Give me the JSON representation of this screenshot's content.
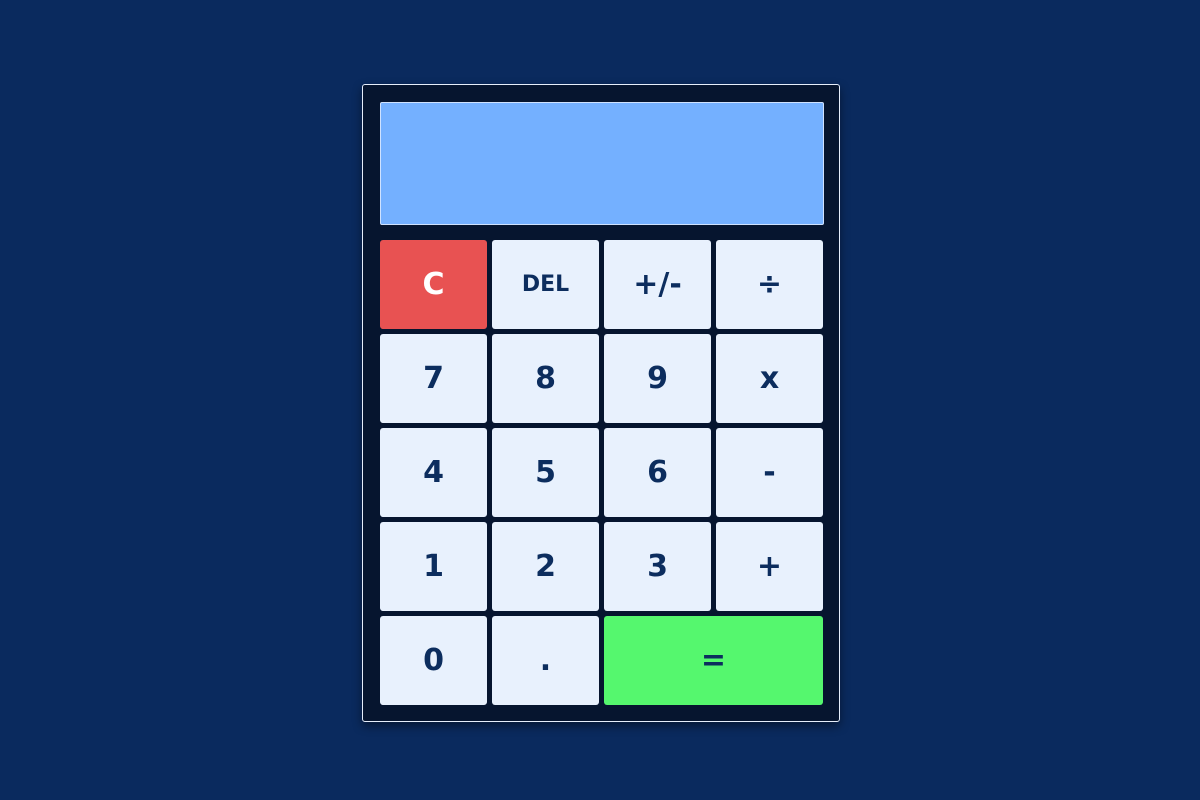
{
  "display": {
    "value": ""
  },
  "keys": {
    "clear": "C",
    "delete": "DEL",
    "negate": "+/-",
    "divide": "÷",
    "seven": "7",
    "eight": "8",
    "nine": "9",
    "multiply": "x",
    "four": "4",
    "five": "5",
    "six": "6",
    "subtract": "-",
    "one": "1",
    "two": "2",
    "three": "3",
    "add": "+",
    "zero": "0",
    "decimal": ".",
    "equals": "="
  },
  "colors": {
    "background": "#0a2a5e",
    "calculator_body": "#06152f",
    "display": "#74b0ff",
    "key": "#e8f1fd",
    "key_text": "#0c2d5e",
    "clear_key": "#e85252",
    "equals_key": "#55f76e"
  }
}
